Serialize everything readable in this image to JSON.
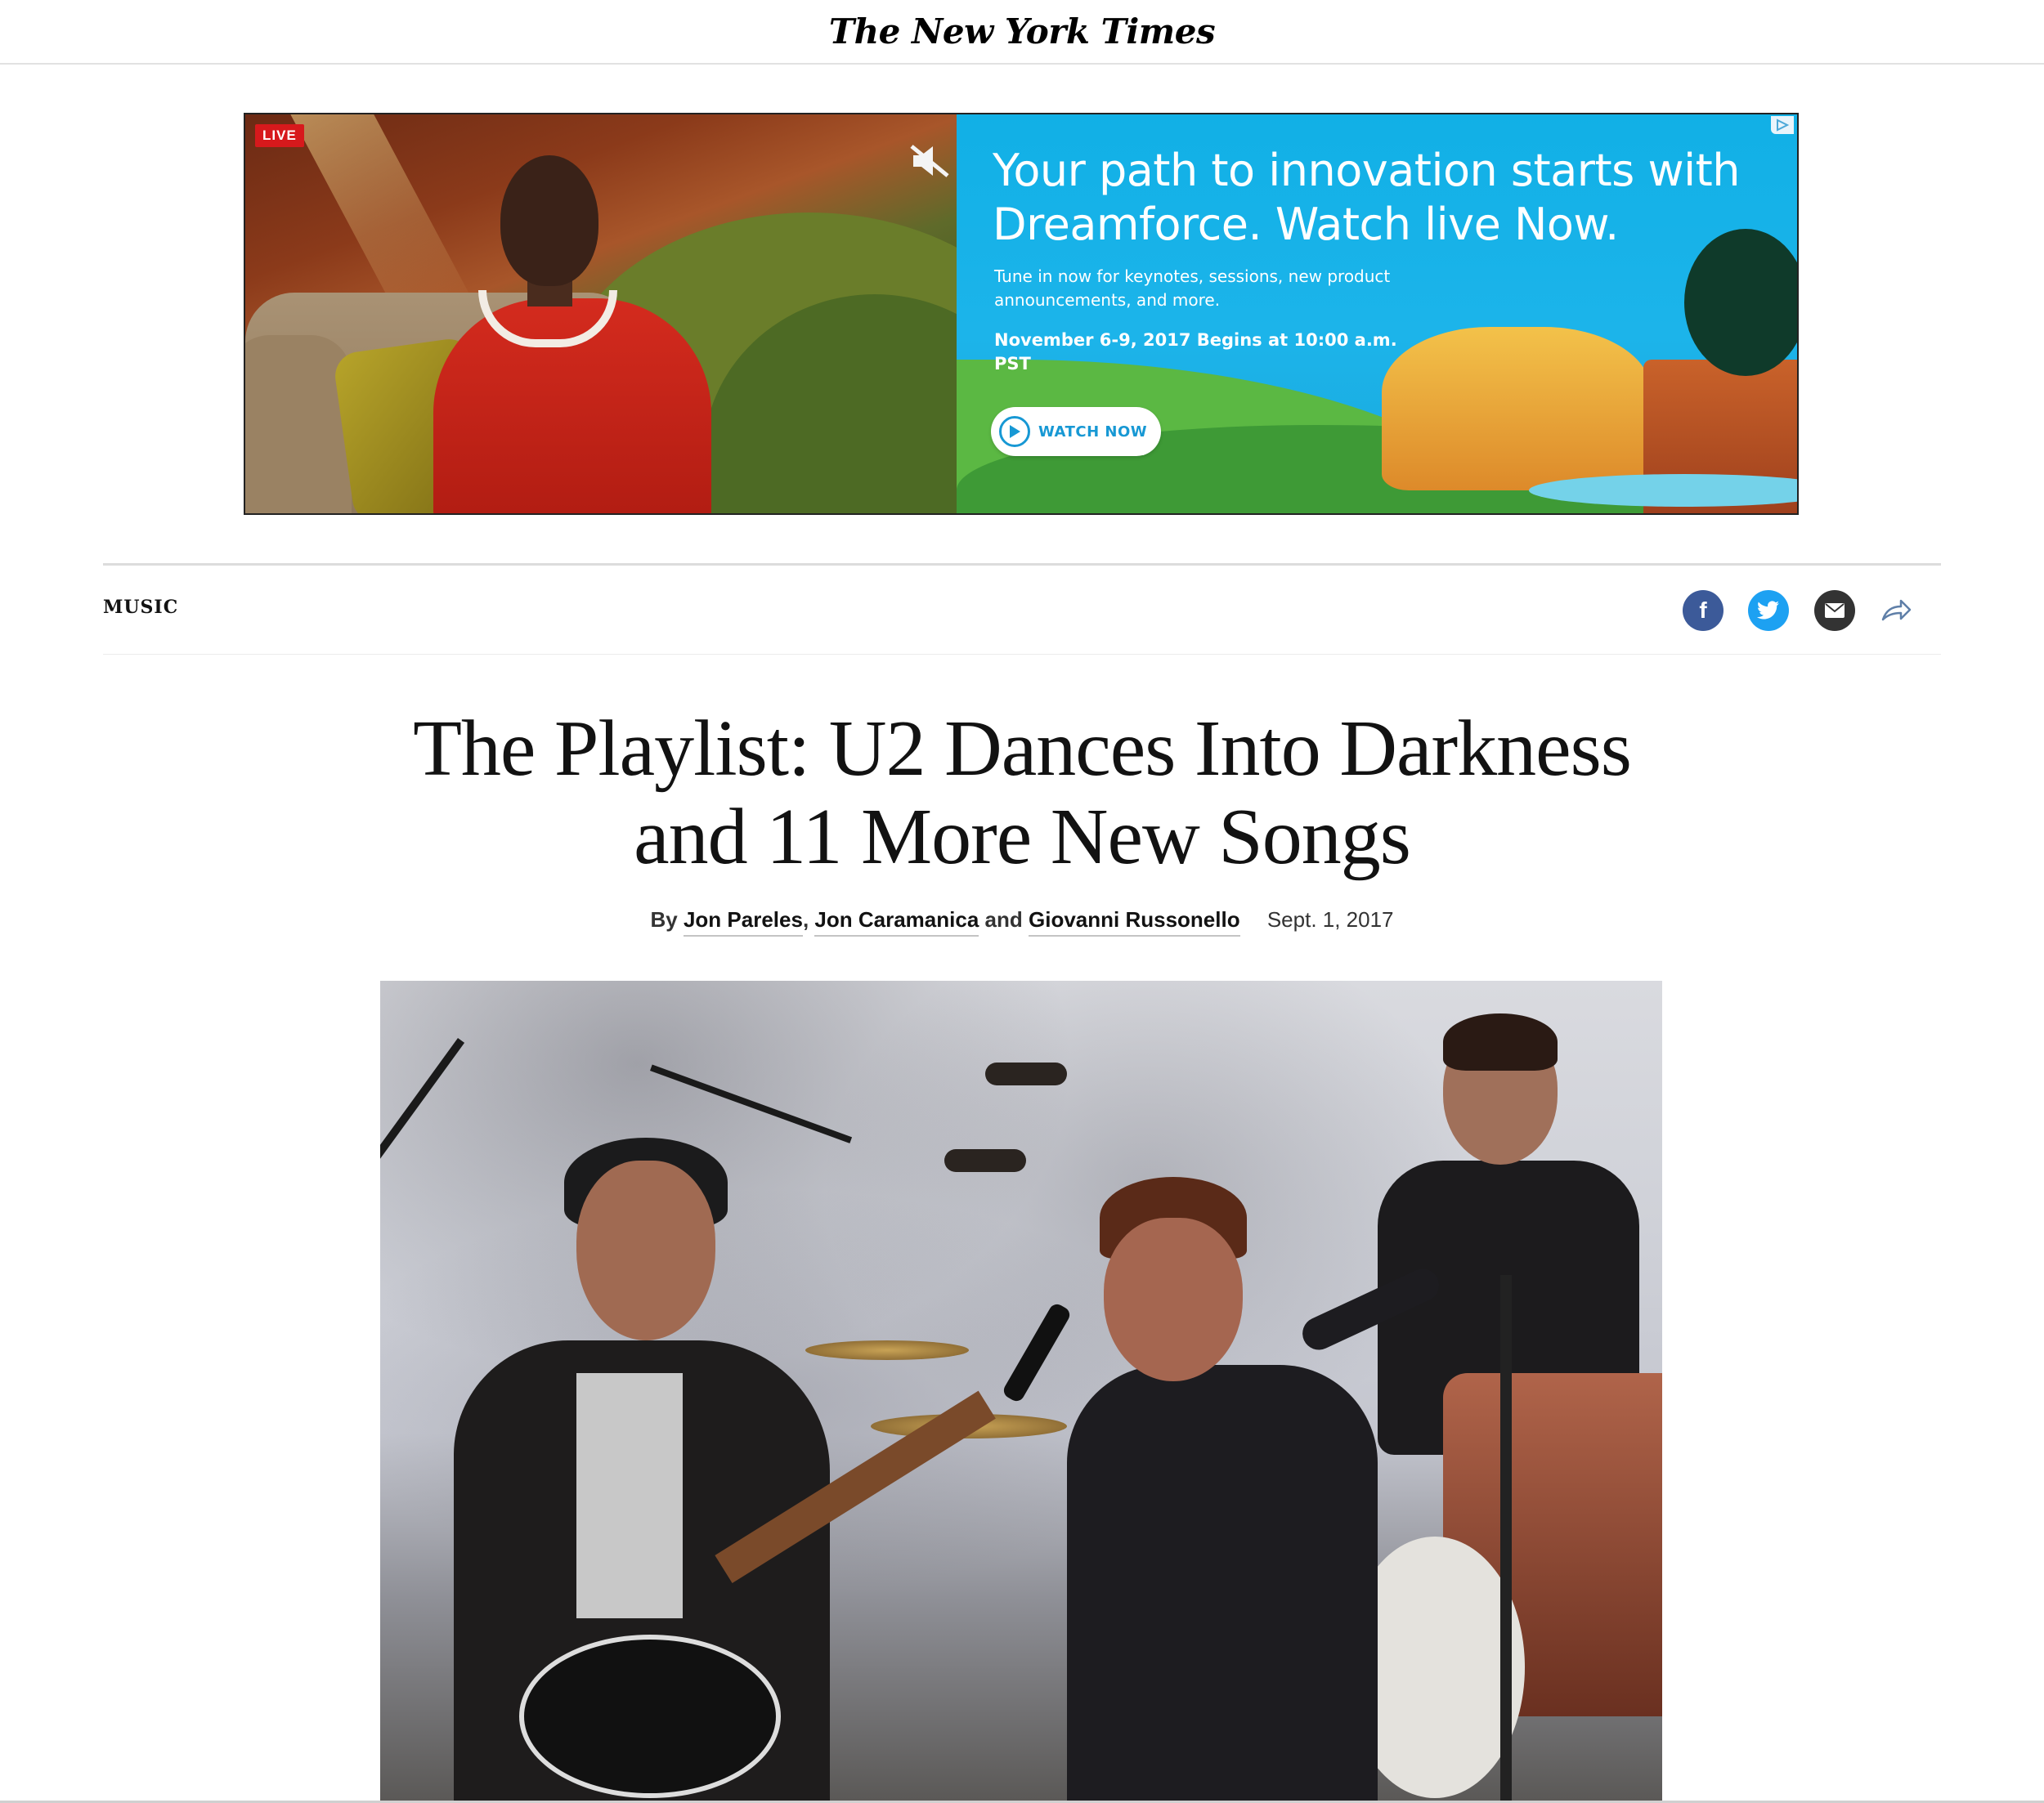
{
  "masthead": {
    "logo": "The New York Times"
  },
  "ad": {
    "live_label": "LIVE",
    "headline": "Your path to innovation starts with Dreamforce. Watch live Now.",
    "subtext": "Tune in now for keynotes, sessions, new product announcements, and more.",
    "dates": "November 6-9, 2017 Begins at 10:00 a.m. PST",
    "cta_label": "WATCH NOW",
    "mute_icon": "mute-icon",
    "adchoices_icon": "adchoices-icon"
  },
  "section": {
    "label": "MUSIC",
    "share_icons": [
      "facebook-icon",
      "twitter-icon",
      "email-icon",
      "share-icon"
    ]
  },
  "article": {
    "headline_line1": "The Playlist: U2 Dances Into Darkness",
    "headline_line2": "and 11 More New Songs",
    "by": "By",
    "authors": [
      "Jon Pareles",
      "Jon Caramanica",
      "Giovanni Russonello"
    ],
    "separator_comma": ",",
    "separator_and": "and",
    "date": "Sept. 1, 2017"
  },
  "colors": {
    "facebook": "#3c5a99",
    "twitter": "#1da1f2",
    "email": "#333333",
    "ad_blue": "#11b0e6",
    "live_red": "#d7191c"
  }
}
